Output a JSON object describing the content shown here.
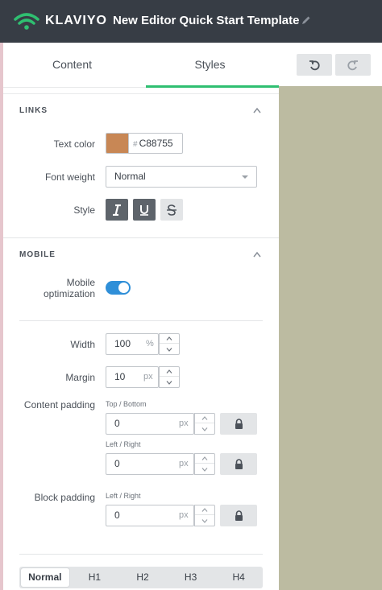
{
  "header": {
    "brand": "KLAVIYO",
    "title": "New Editor Quick Start Template",
    "colors": {
      "bar": "#373d45",
      "logo": "#2fbf71"
    }
  },
  "tabs": [
    {
      "label": "Content",
      "active": false
    },
    {
      "label": "Styles",
      "active": true
    }
  ],
  "links": {
    "section_title": "LINKS",
    "text_color_label": "Text color",
    "text_color_hash": "#",
    "text_color_value": "C88755",
    "swatch_color": "#c88755",
    "font_weight_label": "Font weight",
    "font_weight_value": "Normal",
    "style_label": "Style",
    "style_buttons": [
      {
        "icon": "italic-icon",
        "active": true
      },
      {
        "icon": "underline-icon",
        "active": true
      },
      {
        "icon": "strikethrough-icon",
        "active": false
      }
    ]
  },
  "mobile": {
    "section_title": "MOBILE",
    "optimization_label_line1": "Mobile",
    "optimization_label_line2": "optimization",
    "optimization_on": true,
    "width_label": "Width",
    "width_value": "100",
    "width_unit": "%",
    "margin_label": "Margin",
    "margin_value": "10",
    "margin_unit": "px",
    "content_padding_label": "Content padding",
    "top_bottom_label": "Top / Bottom",
    "top_bottom_value": "0",
    "top_bottom_unit": "px",
    "left_right_label": "Left / Right",
    "left_right_value": "0",
    "left_right_unit": "px",
    "block_padding_label": "Block padding",
    "block_left_right_label": "Left / Right",
    "block_left_right_value": "0",
    "block_left_right_unit": "px"
  },
  "heading_levels": [
    "Normal",
    "H1",
    "H2",
    "H3",
    "H4"
  ],
  "toolbar": {
    "undo_icon": "undo-icon",
    "redo_icon": "redo-icon"
  },
  "accent_color": "#2fbf71",
  "toggle_color": "#2f8fd8",
  "canvas_color": "#bcbba1"
}
